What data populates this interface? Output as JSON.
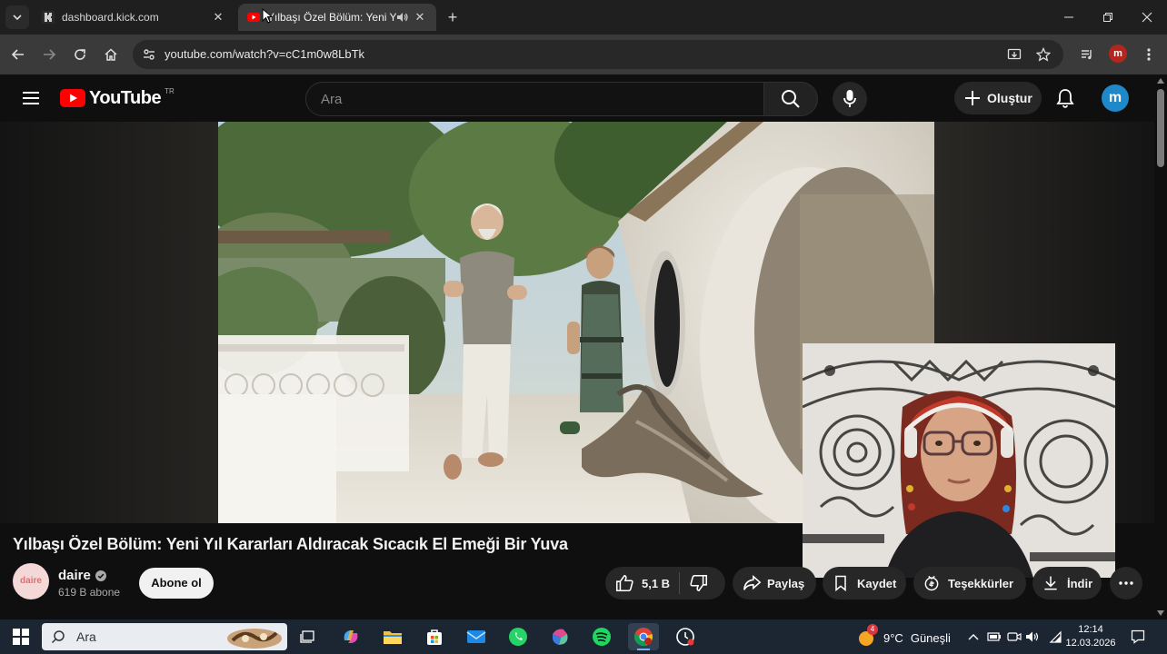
{
  "browser": {
    "tabs": [
      {
        "title": "dashboard.kick.com",
        "active": false
      },
      {
        "title": "Yılbaşı Özel Bölüm: Yeni Yıl",
        "active": true
      }
    ],
    "url": "youtube.com/watch?v=cC1m0w8LbTk",
    "profile_initial": "m"
  },
  "youtube": {
    "logo_text": "YouTube",
    "country_code": "TR",
    "search_placeholder": "Ara",
    "create_label": "Oluştur",
    "avatar_initial": "m"
  },
  "video": {
    "title": "Yılbaşı Özel Bölüm: Yeni Yıl Kararları Aldıracak Sıcacık El Emeği Bir Yuva",
    "channel": {
      "name": "daire",
      "avatar_text": "daire",
      "subscribers": "619 B abone",
      "verified": true
    },
    "subscribe_label": "Abone ol",
    "actions": {
      "likes": "5,1 B",
      "share": "Paylaş",
      "save": "Kaydet",
      "thanks": "Teşekkürler",
      "download": "İndir"
    }
  },
  "taskbar": {
    "search_placeholder": "Ara",
    "weather": {
      "temp": "9°C",
      "condition": "Güneşli",
      "badge": "4"
    },
    "time": "12:14",
    "date": "12.03.2026"
  },
  "colors": {
    "youtube_red": "#ff0000",
    "background": "#0f0f0f",
    "chip": "#272727",
    "taskbar": "#1c2532"
  }
}
